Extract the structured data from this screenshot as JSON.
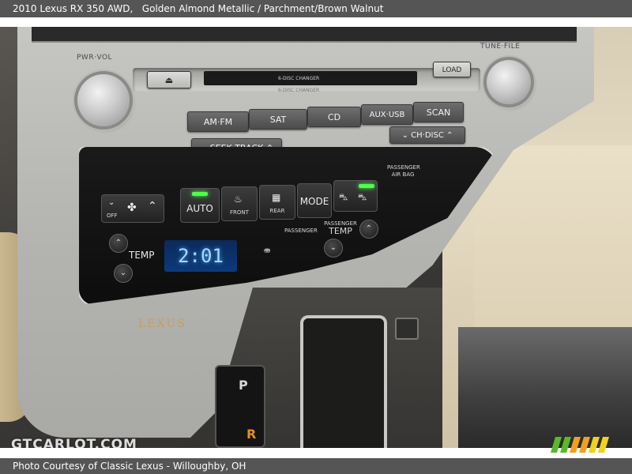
{
  "header": {
    "title": "2010 Lexus RX 350 AWD,",
    "subtitle": "Golden Almond Metallic / Parchment/Brown Walnut"
  },
  "footer": {
    "credit": "Photo Courtesy of Classic Lexus - Willoughby, OH"
  },
  "photo": {
    "radio": {
      "pwr_vol": "PWR·VOL",
      "tune_file": "TUNE·FILE",
      "slot_line_1": "6-DISC CHANGER",
      "slot_line_2": "6-DISC CHANGER",
      "load": "LOAD",
      "eject_icon": "eject-icon",
      "buttons": [
        "AM·FM",
        "SAT",
        "CD",
        "AUX·USB",
        "SCAN"
      ],
      "seek_track": "SEEK·TRACK",
      "ch_disc": "CH·DISC"
    },
    "climate": {
      "off": "OFF",
      "auto": "AUTO",
      "front": "FRONT",
      "rear": "REAR",
      "mode": "MODE",
      "temp": "TEMP",
      "display": "2:01",
      "passenger": "PASSENGER",
      "passenger_temp_line1": "PASSENGER",
      "passenger_temp_line2": "TEMP",
      "passenger_airbag_line1": "PASSENGER",
      "passenger_airbag_line2": "AIR BAG",
      "led_color": "#4bff4b",
      "lcd_color": "#a8d8ff"
    },
    "brand": "LEXUS",
    "shifter": {
      "gear_p": "P",
      "gear_r": "R"
    }
  },
  "watermark": "GTCARLOT.COM",
  "colors": {
    "bar": "#555555",
    "lexus_gold": "#c7a05a",
    "gear_r": "#e0901a",
    "stripe_green": "#5ab82a",
    "stripe_orange": "#f0a020",
    "stripe_yellow": "#f0d020"
  }
}
